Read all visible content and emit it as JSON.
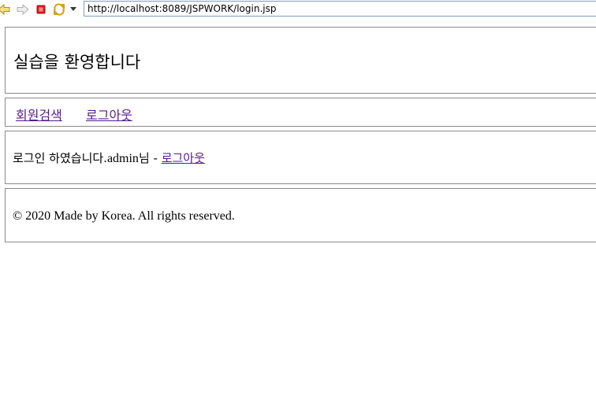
{
  "browser": {
    "url": "http://localhost:8089/JSPWORK/login.jsp",
    "icons": [
      "back-arrow-icon",
      "forward-arrow-icon",
      "stop-icon",
      "refresh-icon",
      "dropdown-icon"
    ]
  },
  "header": {
    "title": "실습을 환영합니다"
  },
  "nav": {
    "links": [
      {
        "label": "회원검색"
      },
      {
        "label": "로그아웃"
      }
    ]
  },
  "content": {
    "message_prefix": "로그인 하였습니다.",
    "user": "admin",
    "message_suffix": "님 - ",
    "logout_link": "로그아웃"
  },
  "footer": {
    "text": "© 2020 Made by Korea. All rights reserved."
  },
  "colors": {
    "visited_link": "#551a8b",
    "border": "#8a8a8a",
    "stop": "#e02020"
  }
}
